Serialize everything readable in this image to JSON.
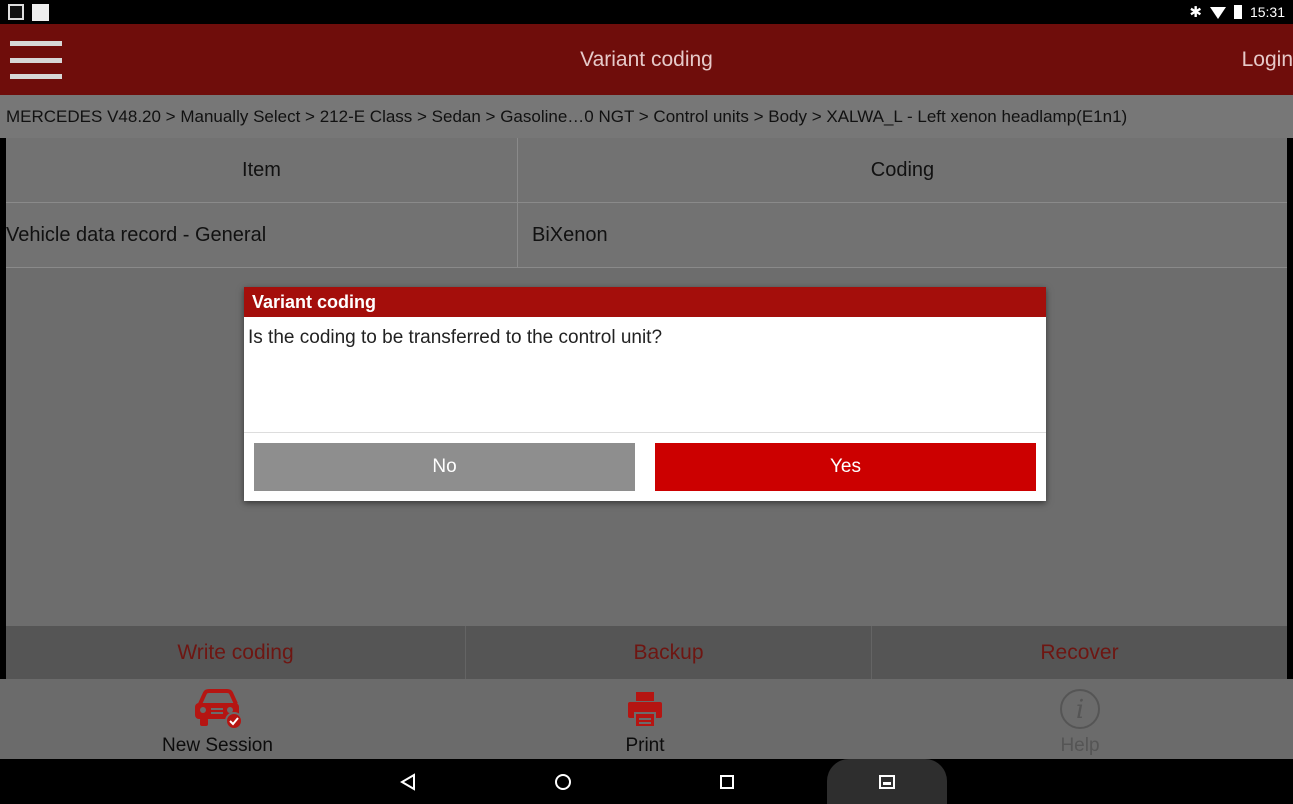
{
  "status_bar": {
    "time": "15:31",
    "bluetooth_glyph": "✱"
  },
  "app_bar": {
    "title": "Variant coding",
    "login_label": "Login"
  },
  "breadcrumb": "MERCEDES V48.20 > Manually Select > 212-E Class > Sedan > Gasoline…0 NGT > Control units > Body > XALWA_L - Left xenon headlamp(E1n1)",
  "table": {
    "headers": [
      "Item",
      "Coding"
    ],
    "rows": [
      {
        "item": "Vehicle data record - General",
        "coding": "BiXenon"
      }
    ]
  },
  "actions": {
    "write_coding": "Write coding",
    "backup": "Backup",
    "recover": "Recover"
  },
  "bottom_nav": {
    "new_session": "New Session",
    "print": "Print",
    "help": "Help"
  },
  "dialog": {
    "title": "Variant coding",
    "message": "Is the coding to be transferred to the control unit?",
    "no_label": "No",
    "yes_label": "Yes"
  },
  "colors": {
    "app_bar": "#6f0d0b",
    "dialog_title": "#a40e0b",
    "accent_red": "#cc0000",
    "disabled_text": "#6e1612"
  },
  "icons": {
    "new_session": "car-check-icon",
    "print": "printer-icon",
    "help": "info-icon",
    "back": "back-triangle-icon",
    "home": "home-circle-icon",
    "recents": "recents-square-icon",
    "screenshot": "image-icon"
  }
}
